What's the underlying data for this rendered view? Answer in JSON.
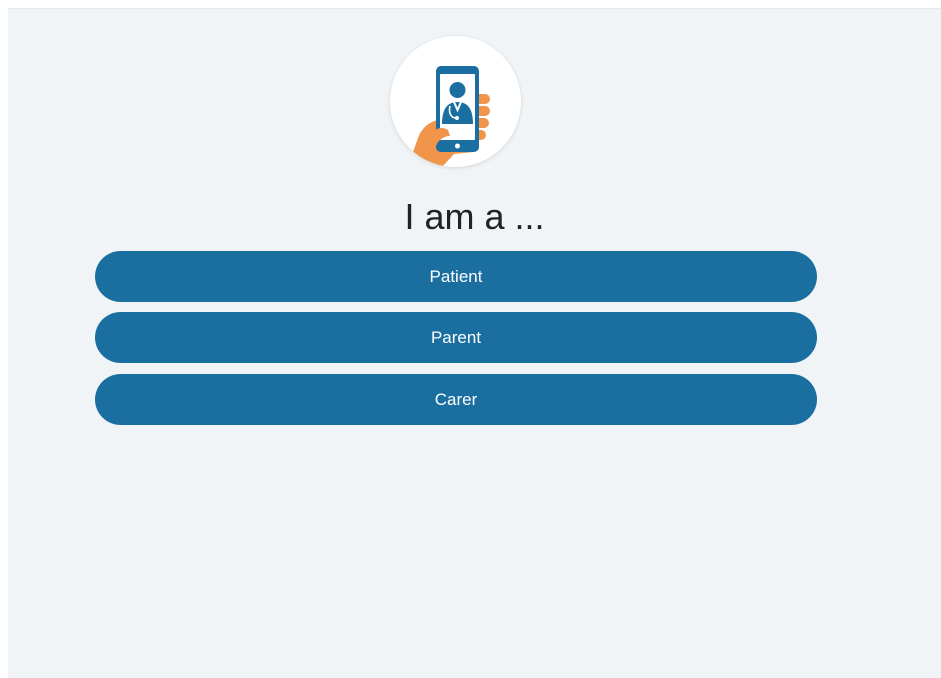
{
  "header": {
    "logo_icon": "phone-doctor-hand-icon",
    "title": "I am a ..."
  },
  "roles": [
    {
      "label": "Patient"
    },
    {
      "label": "Parent"
    },
    {
      "label": "Carer"
    }
  ],
  "colors": {
    "background": "#f1f4f7",
    "button": "#1b6fa0",
    "button_text": "#ffffff",
    "hand": "#f0954a",
    "phone": "#1b6fa0"
  }
}
